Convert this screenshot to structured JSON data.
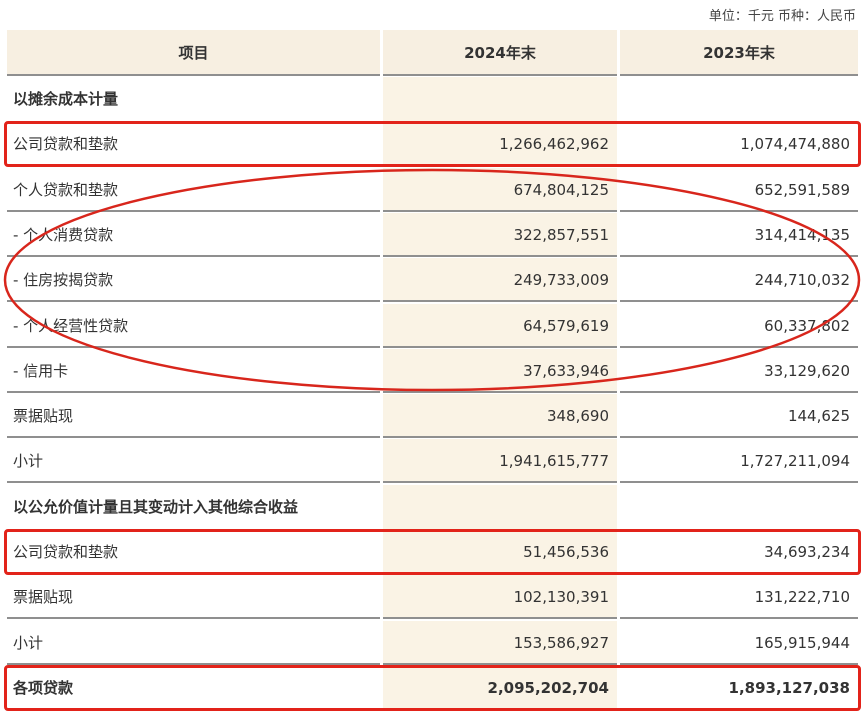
{
  "unit_label": "单位：千元 币种：人民币",
  "header": {
    "item": "项目",
    "col_2024": "2024年末",
    "col_2023": "2023年末"
  },
  "rows": [
    {
      "type": "section",
      "label": "以摊余成本计量",
      "v2024": "",
      "v2023": ""
    },
    {
      "type": "data",
      "label": "公司贷款和垫款",
      "v2024": "1,266,462,962",
      "v2023": "1,074,474,880",
      "highlight": "box"
    },
    {
      "type": "data",
      "label": "个人贷款和垫款",
      "v2024": "674,804,125",
      "v2023": "652,591,589",
      "highlight": "ellipse"
    },
    {
      "type": "data",
      "label": "- 个人消费贷款",
      "v2024": "322,857,551",
      "v2023": "314,414,135",
      "highlight": "ellipse"
    },
    {
      "type": "data",
      "label": "- 住房按揭贷款",
      "v2024": "249,733,009",
      "v2023": "244,710,032",
      "highlight": "ellipse"
    },
    {
      "type": "data",
      "label": "- 个人经营性贷款",
      "v2024": "64,579,619",
      "v2023": "60,337,802",
      "highlight": "ellipse"
    },
    {
      "type": "data",
      "label": "- 信用卡",
      "v2024": "37,633,946",
      "v2023": "33,129,620",
      "highlight": "ellipse"
    },
    {
      "type": "data",
      "label": "票据贴现",
      "v2024": "348,690",
      "v2023": "144,625"
    },
    {
      "type": "data",
      "label": "小计",
      "v2024": "1,941,615,777",
      "v2023": "1,727,211,094"
    },
    {
      "type": "section",
      "label": "以公允价值计量且其变动计入其他综合收益",
      "v2024": "",
      "v2023": ""
    },
    {
      "type": "data",
      "label": "公司贷款和垫款",
      "v2024": "51,456,536",
      "v2023": "34,693,234",
      "highlight": "box"
    },
    {
      "type": "data",
      "label": "票据贴现",
      "v2024": "102,130,391",
      "v2023": "131,222,710"
    },
    {
      "type": "data",
      "label": "小计",
      "v2024": "153,586,927",
      "v2023": "165,915,944"
    },
    {
      "type": "total",
      "label": "各项贷款",
      "v2024": "2,095,202,704",
      "v2023": "1,893,127,038",
      "highlight": "box"
    }
  ],
  "colors": {
    "highlight": "#e2231a",
    "header_bg": "#f7efe1",
    "col_bg": "#faf3e5"
  }
}
